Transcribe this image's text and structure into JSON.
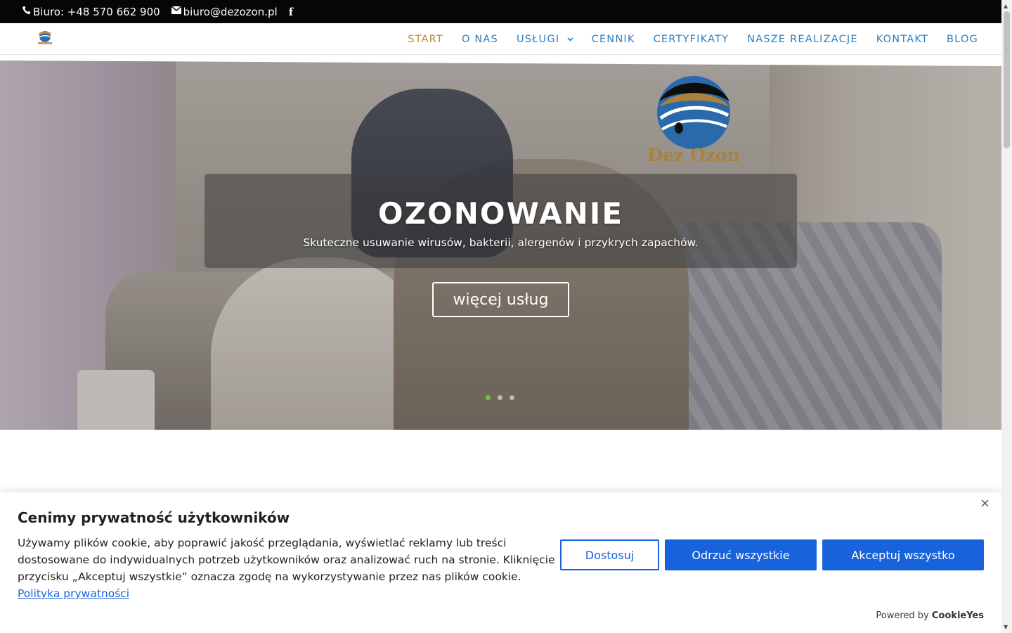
{
  "topbar": {
    "phone": "Biuro: +48 570 662 900",
    "email": "biuro@dezozon.pl",
    "facebook_icon": "facebook-icon"
  },
  "nav": {
    "items": [
      {
        "label": "START",
        "active": true
      },
      {
        "label": "O NAS"
      },
      {
        "label": "USŁUGI",
        "dropdown": true
      },
      {
        "label": "CENNIK"
      },
      {
        "label": "CERTYFIKATY"
      },
      {
        "label": "NASZE REALIZACJE"
      },
      {
        "label": "KONTAKT"
      },
      {
        "label": "BLOG"
      }
    ],
    "active_color": "#b88a3a",
    "link_color": "#2b7fc3"
  },
  "hero": {
    "logo_text": "Dez Ozon",
    "title": "OZONOWANIE",
    "subtitle": "Skuteczne usuwanie wirusów, bakterii, alergenów i przykrych zapachów.",
    "button": "więcej usług",
    "slides": 3,
    "active_slide": 1,
    "active_dot_color": "#6ec83d"
  },
  "cookie": {
    "title": "Cenimy prywatność użytkowników",
    "text": "Używamy plików cookie, aby poprawić jakość przeglądania, wyświetlać reklamy lub treści dostosowane do indywidualnych potrzeb użytkowników oraz analizować ruch na stronie. Kliknięcie przycisku „Akceptuj wszystkie” oznacza zgodę na wykorzystywanie przez nas plików cookie.",
    "policy_link": "Polityka prywatności",
    "btn_customize": "Dostosuj",
    "btn_reject": "Odrzuć wszystkie",
    "btn_accept": "Akceptuj wszystko",
    "powered_by": "Powered by",
    "brand": "CookieYes",
    "close_icon": "close-icon",
    "accent_color": "#1863dc"
  }
}
